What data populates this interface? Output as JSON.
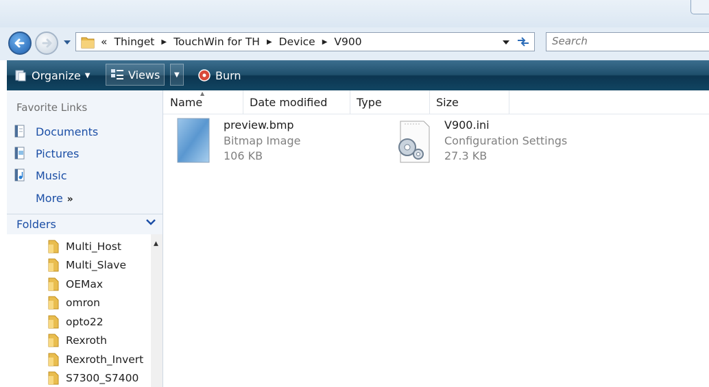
{
  "address": {
    "crumbs": [
      "«",
      "Thinget",
      "TouchWin for TH",
      "Device",
      "V900"
    ],
    "separator": "▶"
  },
  "search": {
    "placeholder": "Search"
  },
  "toolbar": {
    "organize": "Organize",
    "views": "Views",
    "burn": "Burn"
  },
  "nav": {
    "favorite_links_title": "Favorite Links",
    "links": [
      "Documents",
      "Pictures",
      "Music"
    ],
    "more": "More",
    "folders_title": "Folders",
    "folders": [
      "Multi_Host",
      "Multi_Slave",
      "OEMax",
      "omron",
      "opto22",
      "Rexroth",
      "Rexroth_Invert",
      "S7300_S7400"
    ]
  },
  "columns": [
    "Name",
    "Date modified",
    "Type",
    "Size"
  ],
  "files": [
    {
      "name": "preview.bmp",
      "type": "Bitmap Image",
      "size": "106 KB",
      "icon": "bitmap-image-icon"
    },
    {
      "name": "V900.ini",
      "type": "Configuration Settings",
      "size": "27.3 KB",
      "icon": "config-settings-icon"
    }
  ],
  "colors": {
    "toolbar": "#1f4f6c",
    "link": "#1c4fa6",
    "nav_bg": "#f1f5fa"
  }
}
